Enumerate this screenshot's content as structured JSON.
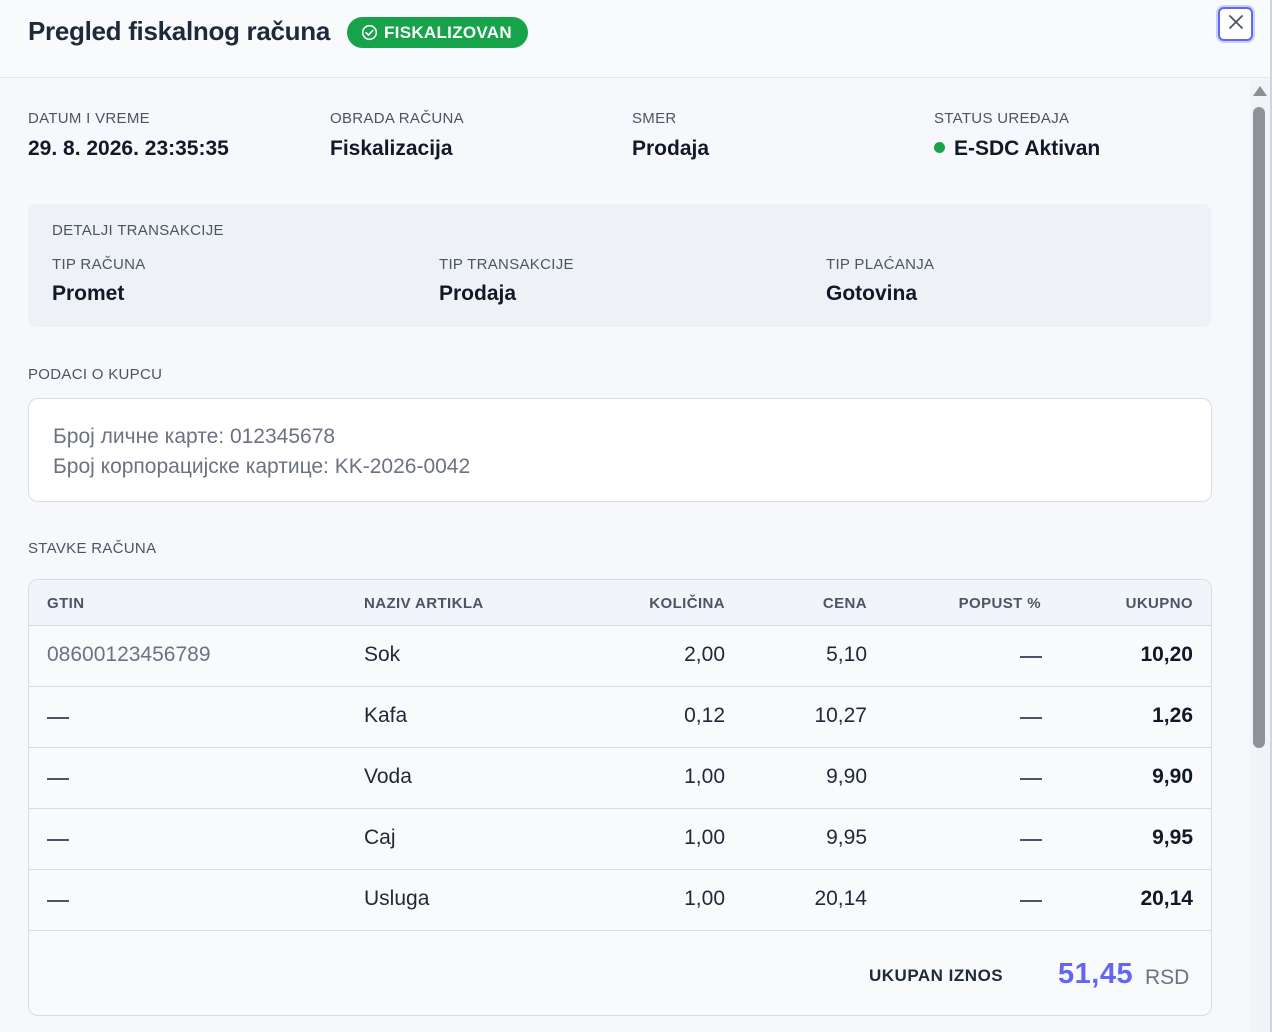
{
  "header": {
    "title": "Pregled fiskalnog računa",
    "badge": "FISKALIZOVAN"
  },
  "meta": [
    {
      "label": "DATUM I VREME",
      "value": "29. 8. 2026. 23:35:35"
    },
    {
      "label": "OBRADA RAČUNA",
      "value": "Fiskalizacija"
    },
    {
      "label": "SMER",
      "value": "Prodaja"
    },
    {
      "label": "STATUS UREĐAJA",
      "value": "E-SDC Aktivan"
    }
  ],
  "details": {
    "title": "DETALJI TRANSAKCIJE",
    "items": [
      {
        "label": "TIP RAČUNA",
        "value": "Promet"
      },
      {
        "label": "TIP TRANSAKCIJE",
        "value": "Prodaja"
      },
      {
        "label": "TIP PLAĆANJA",
        "value": "Gotovina"
      }
    ]
  },
  "customer": {
    "title": "PODACI O KUPCU",
    "lines": [
      "Број личне карте: 012345678",
      "Број корпорацијске картице: KK-2026-0042"
    ]
  },
  "items": {
    "title": "STAVKE RAČUNA",
    "columns": [
      "GTIN",
      "NAZIV ARTIKLA",
      "KOLIČINA",
      "CENA",
      "POPUST %",
      "UKUPNO"
    ],
    "rows": [
      {
        "gtin": "08600123456789",
        "name": "Sok",
        "qty": "2,00",
        "price": "5,10",
        "total": "10,20"
      },
      {
        "gtin": "",
        "name": "Kafa",
        "qty": "0,12",
        "price": "10,27",
        "total": "1,26"
      },
      {
        "gtin": "",
        "name": "Voda",
        "qty": "1,00",
        "price": "9,90",
        "total": "9,90"
      },
      {
        "gtin": "",
        "name": "Caj",
        "qty": "1,00",
        "price": "9,95",
        "total": "9,95"
      },
      {
        "gtin": "",
        "name": "Usluga",
        "qty": "1,00",
        "price": "20,14",
        "total": "20,14"
      }
    ],
    "sum_label": "UKUPAN IZNOS",
    "sum_value": "51,45",
    "currency": "RSD"
  },
  "colors": {
    "badge": "#16a34a",
    "accent": "#6366f1",
    "status": "#16a34a"
  }
}
